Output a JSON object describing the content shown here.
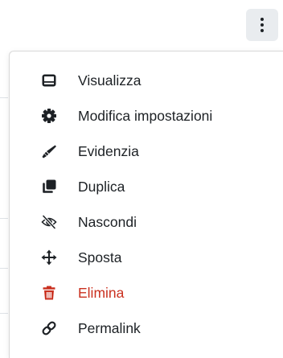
{
  "header": {
    "actions_button_icon": "three-dots-vertical-icon"
  },
  "colors": {
    "text": "#1d2125",
    "danger": "#ca3120",
    "button_bg": "#e9ecef"
  },
  "menu": {
    "items": [
      {
        "label": "Visualizza",
        "icon": "preview-window-icon"
      },
      {
        "label": "Modifica impostazioni",
        "icon": "gear-icon"
      },
      {
        "label": "Evidenzia",
        "icon": "highlighter-pen-icon"
      },
      {
        "label": "Duplica",
        "icon": "copy-icon"
      },
      {
        "label": "Nascondi",
        "icon": "eye-slash-icon"
      },
      {
        "label": "Sposta",
        "icon": "move-arrows-icon"
      },
      {
        "label": "Elimina",
        "icon": "trash-icon"
      },
      {
        "label": "Permalink",
        "icon": "link-icon"
      }
    ]
  }
}
